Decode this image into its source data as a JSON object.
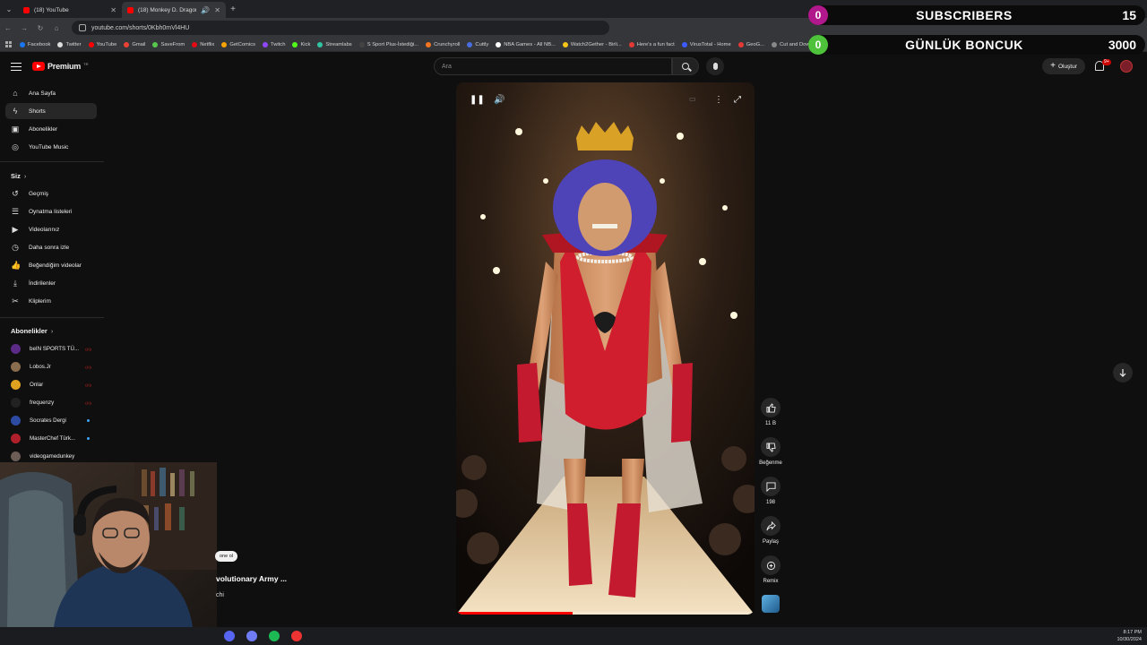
{
  "browser": {
    "tabs": [
      {
        "label": "(18) YouTube",
        "active": false
      },
      {
        "label": "(18) Monkey D. Dragon & ",
        "active": true
      }
    ],
    "url": "youtube.com/shorts/0Kbh0mVl4HU",
    "bookmarks": [
      {
        "label": "Facebook",
        "color": "#1877f2"
      },
      {
        "label": "Twitter",
        "color": "#dddddd"
      },
      {
        "label": "YouTube",
        "color": "#ff0000"
      },
      {
        "label": "Gmail",
        "color": "#ea4335"
      },
      {
        "label": "SaveFrom",
        "color": "#57c84d"
      },
      {
        "label": "Netflix",
        "color": "#e50914"
      },
      {
        "label": "GetComics",
        "color": "#f4a300"
      },
      {
        "label": "Twitch",
        "color": "#9146ff"
      },
      {
        "label": "Kick",
        "color": "#53fc18"
      },
      {
        "label": "Streamlabs",
        "color": "#31c3a2"
      },
      {
        "label": "S Sport Plus-İstediği...",
        "color": "#444444"
      },
      {
        "label": "Crunchyroll",
        "color": "#f47521"
      },
      {
        "label": "Cuttly",
        "color": "#4a6ee0"
      },
      {
        "label": "NBA Games - All NB...",
        "color": "#ffffff"
      },
      {
        "label": "Watch2Gether - Birli...",
        "color": "#f5c518"
      },
      {
        "label": "Here's a fun fact",
        "color": "#e53935"
      },
      {
        "label": "VirusTotal - Home",
        "color": "#3d5afe"
      },
      {
        "label": "GeoG...",
        "color": "#e53935"
      },
      {
        "label": "Cut and Download...",
        "color": "#888888"
      }
    ]
  },
  "overlay": {
    "subscribers_label": "SUBSCRIBERS",
    "subscribers_value": "0",
    "subscribers_goal": "15",
    "daily_label": "GÜNLÜK BONCUK",
    "daily_value": "0",
    "daily_goal": "3000"
  },
  "header": {
    "brand": "Premium",
    "region": "TR",
    "search_placeholder": "Ara",
    "create_label": "Oluştur",
    "notif_badge": "9+"
  },
  "sidebar": {
    "main": [
      {
        "label": "Ana Sayfa",
        "icon": "home-icon",
        "glyph": "⌂"
      },
      {
        "label": "Shorts",
        "icon": "shorts-icon",
        "glyph": "ϟ",
        "active": true
      },
      {
        "label": "Abonelikler",
        "icon": "subscriptions-icon",
        "glyph": "▣"
      },
      {
        "label": "YouTube Music",
        "icon": "music-icon",
        "glyph": "◎"
      }
    ],
    "you_heading": "Siz",
    "you": [
      {
        "label": "Geçmiş",
        "icon": "history-icon",
        "glyph": "↺"
      },
      {
        "label": "Oynatma listeleri",
        "icon": "playlists-icon",
        "glyph": "☰"
      },
      {
        "label": "Videolarınız",
        "icon": "your-videos-icon",
        "glyph": "▶"
      },
      {
        "label": "Daha sonra izle",
        "icon": "watch-later-icon",
        "glyph": "◷"
      },
      {
        "label": "Beğendiğim videolar",
        "icon": "liked-icon",
        "glyph": "👍"
      },
      {
        "label": "İndirilenler",
        "icon": "downloads-icon",
        "glyph": "⤓"
      },
      {
        "label": "Kliplerim",
        "icon": "clips-icon",
        "glyph": "✂"
      }
    ],
    "subs_heading": "Abonelikler",
    "subs": [
      {
        "label": "beIN SPORTS TÜ...",
        "color": "#5b2a86",
        "status": "live"
      },
      {
        "label": "Lobos.Jr",
        "color": "#8a6d4e",
        "status": "live"
      },
      {
        "label": "Onlar",
        "color": "#e0a020",
        "status": "live"
      },
      {
        "label": "frequenzy",
        "color": "#222222",
        "status": "live"
      },
      {
        "label": "Socrates Dergi",
        "color": "#2d4ba3",
        "status": "new"
      },
      {
        "label": "MasterChef Türk...",
        "color": "#b0202a",
        "status": "new"
      },
      {
        "label": "videogamedunkey",
        "color": "#6b5d55",
        "status": ""
      }
    ]
  },
  "player": {
    "progress": 0.39
  },
  "actions": {
    "like_count": "11 B",
    "dislike_label": "Beğenme",
    "comments_count": "198",
    "share_label": "Paylaş",
    "remix_label": "Remix"
  },
  "below": {
    "join_label": "Üye ol",
    "join_visible": "one ol",
    "title": "volutionary Army ...",
    "channel": "chi"
  },
  "taskbar": {
    "time": "8:17 PM",
    "date": "10/30/2024"
  }
}
